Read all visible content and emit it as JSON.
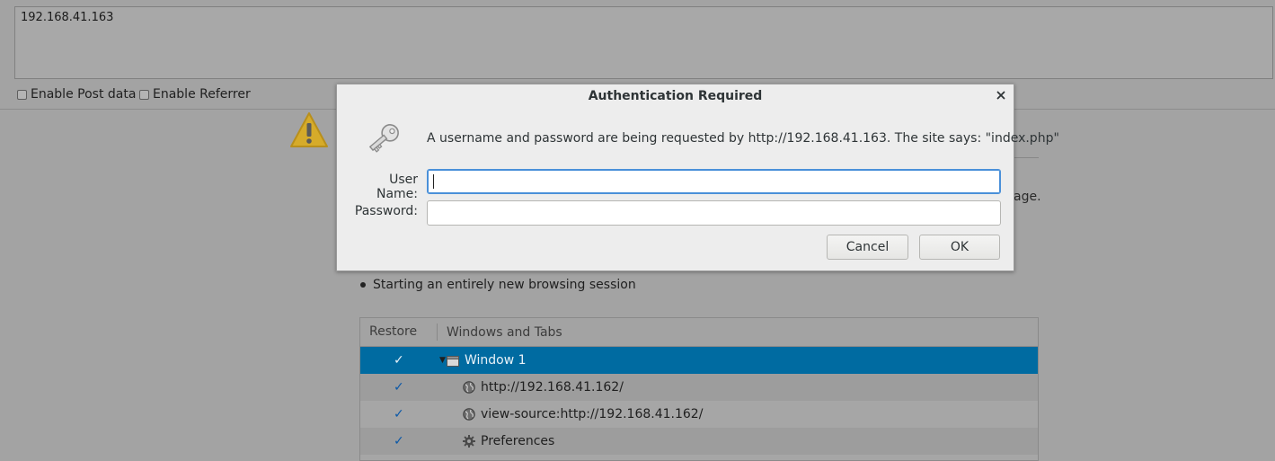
{
  "hackbar": {
    "url": "192.168.41.163",
    "options": [
      {
        "label": "Enable Post data",
        "checked": false
      },
      {
        "label": "Enable Referrer",
        "checked": false
      }
    ]
  },
  "page": {
    "fragment_text": "age.",
    "bullet_text": "Starting an entirely new browsing session",
    "tree": {
      "headers": {
        "restore": "Restore",
        "windows": "Windows and Tabs"
      },
      "rows": [
        {
          "label": "Window 1",
          "checked": true,
          "icon": "window-icon",
          "selected": true
        },
        {
          "label": "http://192.168.41.162/",
          "checked": true,
          "icon": "globe-icon"
        },
        {
          "label": "view-source:http://192.168.41.162/",
          "checked": true,
          "icon": "globe-icon"
        },
        {
          "label": "Preferences",
          "checked": true,
          "icon": "gear-icon"
        }
      ]
    }
  },
  "dialog": {
    "title": "Authentication Required",
    "message": "A username and password are being requested by http://192.168.41.163. The site says: \"index.php\"",
    "username_label": "User Name:",
    "password_label": "Password:",
    "username_value": "",
    "password_value": "",
    "cancel_label": "Cancel",
    "ok_label": "OK"
  },
  "colors": {
    "selection": "#006ba1",
    "checkmark": "#0a58a8",
    "warning": "#e5b72b"
  }
}
